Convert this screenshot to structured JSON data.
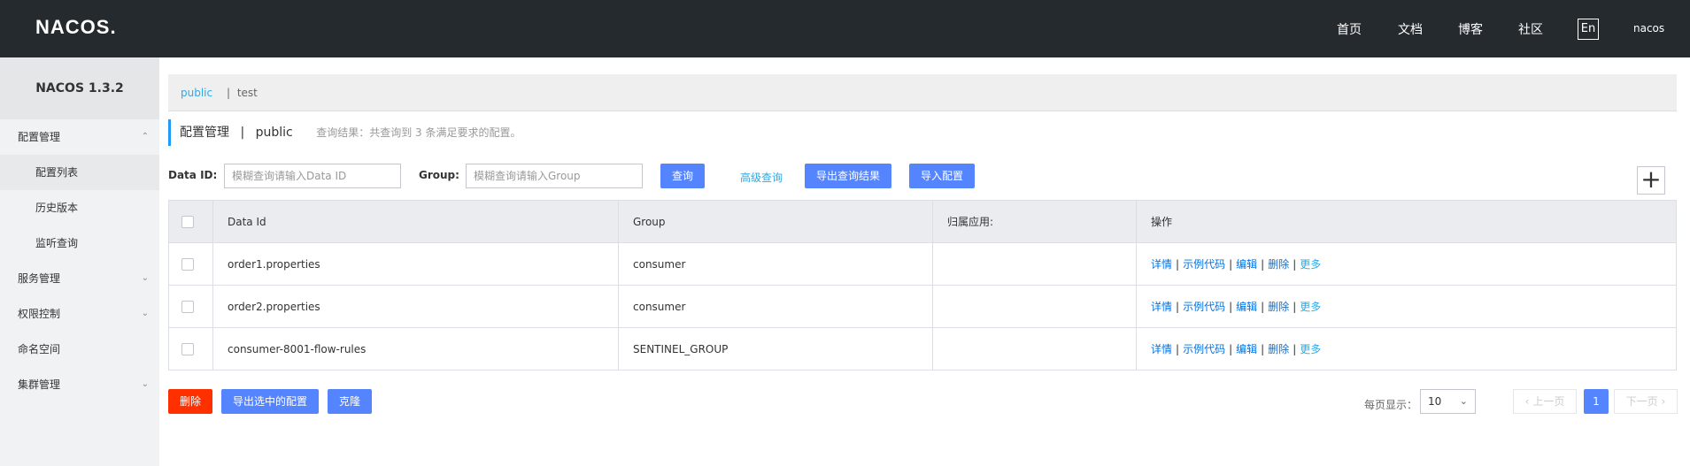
{
  "header": {
    "logo": "NACOS.",
    "nav": [
      "首页",
      "文档",
      "博客",
      "社区"
    ],
    "lang": "En",
    "user": "nacos"
  },
  "sidebar": {
    "version": "NACOS 1.3.2",
    "items": [
      {
        "label": "配置管理"
      },
      {
        "label": "配置列表"
      },
      {
        "label": "历史版本"
      },
      {
        "label": "监听查询"
      },
      {
        "label": "服务管理"
      },
      {
        "label": "权限控制"
      },
      {
        "label": "命名空间"
      },
      {
        "label": "集群管理"
      }
    ]
  },
  "namespaces": {
    "active": "public",
    "other": "test"
  },
  "page": {
    "title": "配置管理",
    "namespace": "public",
    "result": "查询结果：共查询到 3 条满足要求的配置。"
  },
  "search": {
    "dataid_label": "Data ID:",
    "dataid_placeholder": "模糊查询请输入Data ID",
    "group_label": "Group:",
    "group_placeholder": "模糊查询请输入Group",
    "query_btn": "查询",
    "advanced": "高级查询",
    "export_btn": "导出查询结果",
    "import_btn": "导入配置"
  },
  "table": {
    "headers": [
      "Data Id",
      "Group",
      "归属应用:",
      "操作"
    ],
    "rows": [
      {
        "dataid": "order1.properties",
        "group": "consumer",
        "app": ""
      },
      {
        "dataid": "order2.properties",
        "group": "consumer",
        "app": ""
      },
      {
        "dataid": "consumer-8001-flow-rules",
        "group": "SENTINEL_GROUP",
        "app": ""
      }
    ],
    "ops": [
      "详情",
      "示例代码",
      "编辑",
      "删除",
      "更多"
    ]
  },
  "footer": {
    "delete_btn": "删除",
    "export_selected": "导出选中的配置",
    "clone_btn": "克隆",
    "per_page_label": "每页显示：",
    "per_page": "10",
    "prev": "上一页",
    "page": "1",
    "next": "下一页"
  },
  "colors": {
    "topbar": "#252a2f",
    "primary": "#5584ff",
    "danger": "#ff3000",
    "link": "#2ea9e5"
  }
}
